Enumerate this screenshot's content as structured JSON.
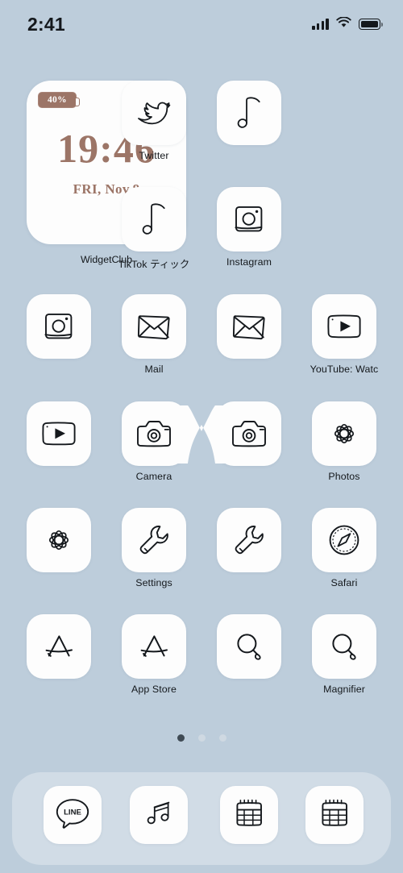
{
  "status_bar": {
    "time": "2:41",
    "signal_icon": "cellular-bars-icon",
    "wifi_icon": "wifi-icon",
    "battery_icon": "battery-full-icon"
  },
  "wallpaper_color": "#bdcddb",
  "accent_color": "#9c7567",
  "widget": {
    "name": "clock-widget",
    "battery_badge": "40%",
    "time": "19:46",
    "date": "FRI, Nov.8",
    "label": "WidgetClub"
  },
  "home_grid": {
    "rows": [
      {
        "apps": [
          {
            "label": "Twitter",
            "icon": "twitter-bird-icon",
            "col": 1
          },
          {
            "label": "",
            "icon": "music-note-icon",
            "col": 2
          }
        ]
      },
      {
        "apps": [
          {
            "label": "TikTok ティック",
            "icon": "music-note-icon",
            "col": 1
          },
          {
            "label": "Instagram",
            "icon": "camera-square-icon",
            "col": 2
          }
        ]
      },
      {
        "apps": [
          {
            "label": "",
            "icon": "camera-square-icon",
            "col": 0
          },
          {
            "label": "Mail",
            "icon": "envelope-icon",
            "col": 1
          },
          {
            "label": "",
            "icon": "envelope-icon",
            "col": 2
          },
          {
            "label": "YouTube: Watc",
            "icon": "youtube-play-icon",
            "col": 3
          }
        ]
      },
      {
        "apps": [
          {
            "label": "",
            "icon": "youtube-play-icon",
            "col": 0
          },
          {
            "label": "Camera",
            "icon": "camera-icon",
            "col": 1
          },
          {
            "label": "",
            "icon": "camera-icon",
            "col": 2
          },
          {
            "label": "Photos",
            "icon": "flower-icon",
            "col": 3
          }
        ]
      },
      {
        "apps": [
          {
            "label": "",
            "icon": "flower-icon",
            "col": 0
          },
          {
            "label": "Settings",
            "icon": "wrench-icon",
            "col": 1
          },
          {
            "label": "",
            "icon": "wrench-icon",
            "col": 2
          },
          {
            "label": "Safari",
            "icon": "compass-icon",
            "col": 3
          }
        ]
      },
      {
        "apps": [
          {
            "label": "",
            "icon": "appstore-a-icon",
            "col": 0
          },
          {
            "label": "App Store",
            "icon": "appstore-a-icon",
            "col": 1
          },
          {
            "label": "",
            "icon": "magnifier-icon",
            "col": 2
          },
          {
            "label": "Magnifier",
            "icon": "magnifier-icon",
            "col": 3
          }
        ]
      }
    ],
    "decoration": "heart-between-cameras"
  },
  "page_indicator": {
    "total": 3,
    "active": 1
  },
  "dock": {
    "apps": [
      {
        "label": "LINE",
        "icon": "line-chat-icon"
      },
      {
        "label": "Music",
        "icon": "music-double-note-icon"
      },
      {
        "label": "Calendar",
        "icon": "calendar-icon"
      },
      {
        "label": "Calendar",
        "icon": "calendar-icon"
      }
    ]
  }
}
